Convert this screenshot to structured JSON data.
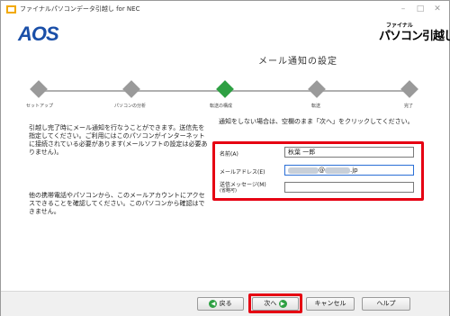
{
  "window": {
    "title": "ファイナルパソコンデータ引越し for NEC",
    "minimize": "–",
    "maximize": "□",
    "close": "✕"
  },
  "header": {
    "logo_left": "AOS",
    "logo_right_small": "ファイナル",
    "logo_right_big": "パソコン引越し"
  },
  "page": {
    "title": "メール通知の設定"
  },
  "steps": [
    {
      "label": "セットアップ",
      "state": "done"
    },
    {
      "label": "パソコンの分析",
      "state": "done"
    },
    {
      "label": "転送の構成",
      "state": "current"
    },
    {
      "label": "転送",
      "state": "todo"
    },
    {
      "label": "完了",
      "state": "todo"
    }
  ],
  "description": {
    "main": "引越し完了時にメール通知を行なうことができます。送信先を指定してください。ご利用にはこのパソコンがインターネットに接続されている必要があります(メールソフトの設定は必要ありません)。",
    "note": "他の携帯電話やパソコンから、このメールアカウントにアクセスできることを確認してください。このパソコンから確認はできません。",
    "hint": "通知をしない場合は、空欄のまま「次へ」をクリックしてください。"
  },
  "form": {
    "name_label": "名前(A)",
    "name_value": "秋葉 一郎",
    "email_label": "メールアドレス(E)",
    "email_at": "@",
    "email_suffix": ".jp",
    "message_label": "送信メッセージ(M)",
    "message_sub": "(省略可)",
    "message_value": ""
  },
  "buttons": {
    "back": "戻る",
    "next": "次へ",
    "cancel": "キャンセル",
    "help": "ヘルプ"
  },
  "colors": {
    "accent_green": "#2ea043",
    "highlight_red": "#e60012",
    "logo_blue": "#1a4fa8",
    "step_gray": "#9a9a9a"
  }
}
